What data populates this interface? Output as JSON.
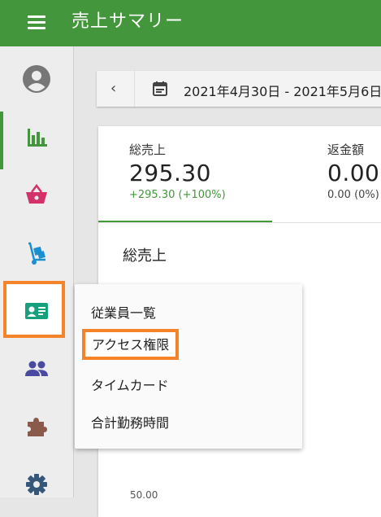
{
  "app": {
    "title": "売上サマリー"
  },
  "date_range": {
    "text": "2021年4月30日 - 2021年5月6日"
  },
  "metrics": [
    {
      "label": "総売上",
      "value": "295.30",
      "change": "+295.30 (+100%)"
    },
    {
      "label": "返金額",
      "value": "0.00",
      "change": "0.00 (0%)"
    }
  ],
  "section": {
    "title": "総売上"
  },
  "chart": {
    "y_tick": "50.00"
  },
  "popup_menu": {
    "items": [
      {
        "label": "従業員一覧"
      },
      {
        "label": "アクセス権限"
      },
      {
        "label": "タイムカード"
      },
      {
        "label": "合計勤務時間"
      }
    ]
  },
  "sidebar": {
    "items": [
      {
        "icon": "account-circle-icon"
      },
      {
        "icon": "bar-chart-icon",
        "color": "#43963c"
      },
      {
        "icon": "basket-icon",
        "color": "#d4306a"
      },
      {
        "icon": "hand-truck-icon",
        "color": "#1b8fd0"
      },
      {
        "icon": "id-card-icon",
        "color": "#17a07e"
      },
      {
        "icon": "people-icon",
        "color": "#4a4aa0"
      },
      {
        "icon": "puzzle-icon",
        "color": "#8a5a4a"
      },
      {
        "icon": "gear-icon",
        "color": "#35587a"
      }
    ]
  },
  "colors": {
    "header": "#43963c",
    "highlight": "#f5832a"
  }
}
